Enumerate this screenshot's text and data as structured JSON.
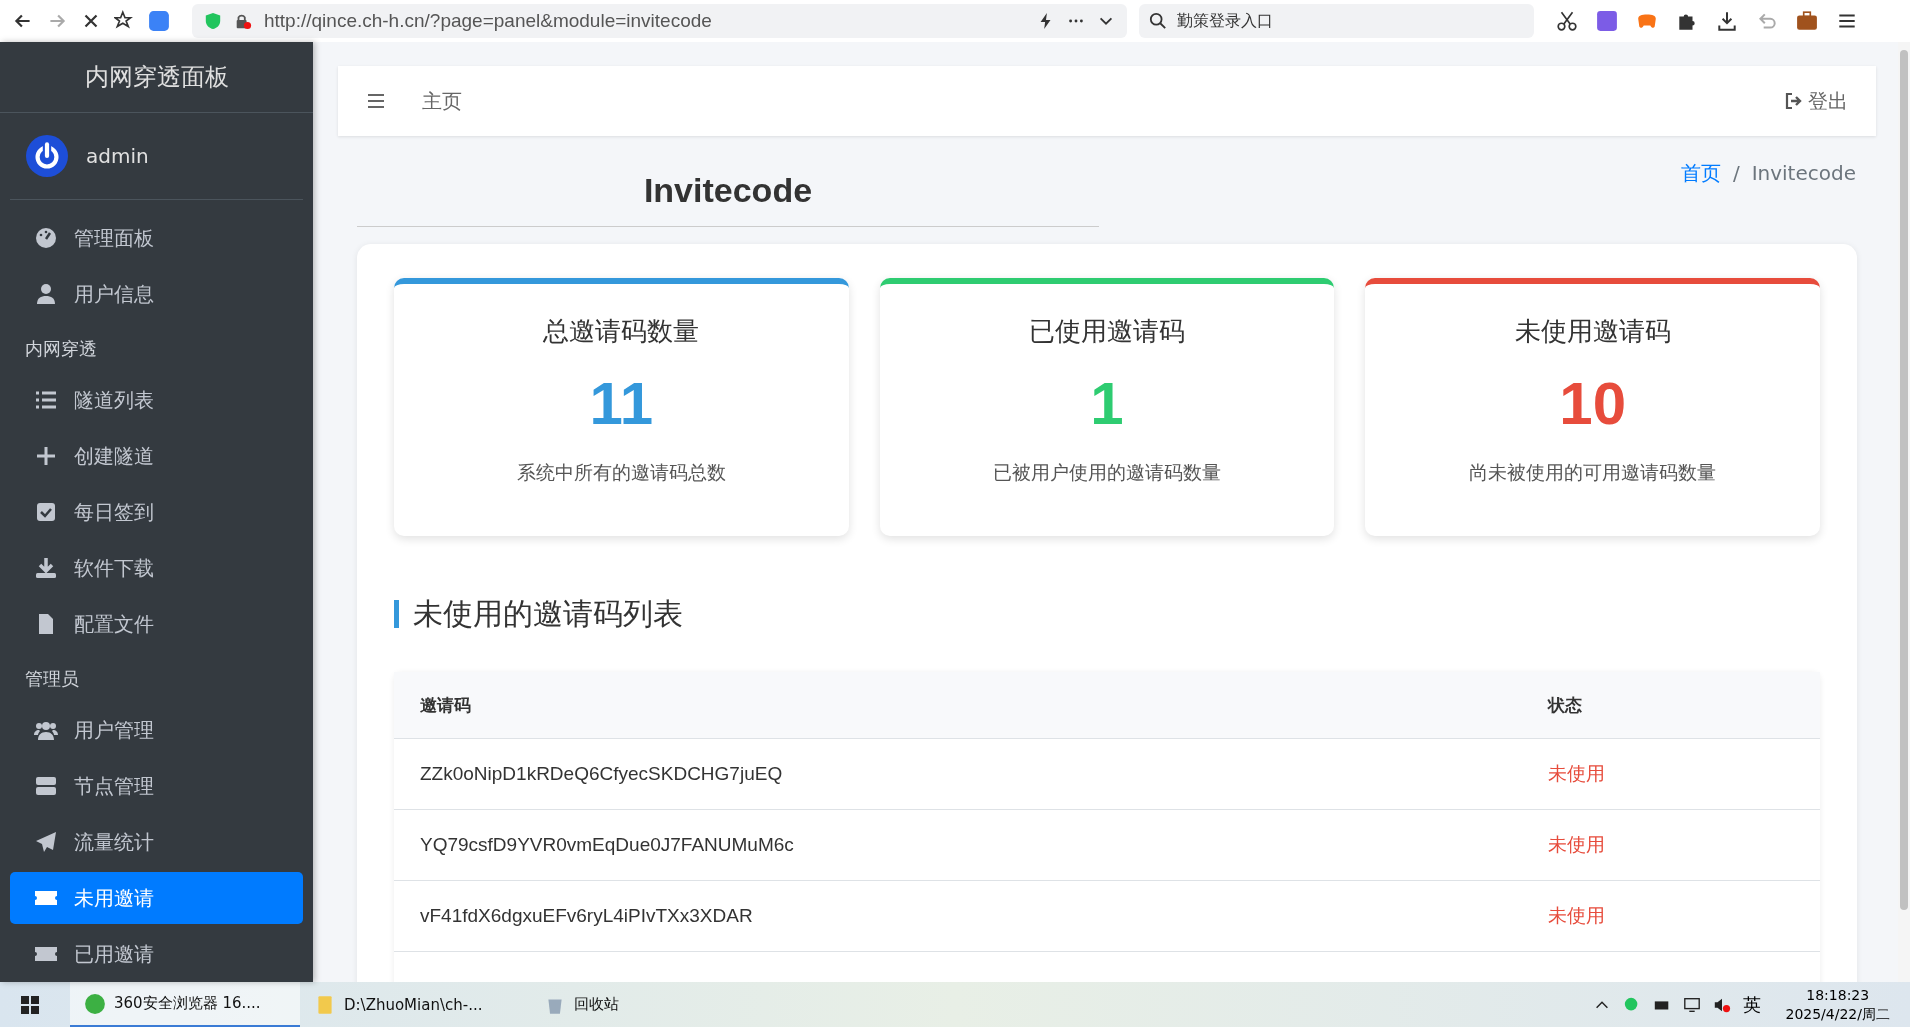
{
  "browser": {
    "url": "http://qince.ch-h.cn/?page=panel&module=invitecode",
    "search": {
      "placeholder": "勤策登录入口"
    }
  },
  "sidebar": {
    "title": "内网穿透面板",
    "user": {
      "name": "admin"
    },
    "items": [
      {
        "kind": "item",
        "label": "管理面板",
        "selected": false
      },
      {
        "kind": "item",
        "label": "用户信息",
        "selected": false
      },
      {
        "kind": "header",
        "label": "内网穿透"
      },
      {
        "kind": "item",
        "label": "隧道列表",
        "selected": false
      },
      {
        "kind": "item",
        "label": "创建隧道",
        "selected": false
      },
      {
        "kind": "item",
        "label": "每日签到",
        "selected": false
      },
      {
        "kind": "item",
        "label": "软件下载",
        "selected": false
      },
      {
        "kind": "item",
        "label": "配置文件",
        "selected": false
      },
      {
        "kind": "header",
        "label": "管理员"
      },
      {
        "kind": "item",
        "label": "用户管理",
        "selected": false
      },
      {
        "kind": "item",
        "label": "节点管理",
        "selected": false
      },
      {
        "kind": "item",
        "label": "流量统计",
        "selected": false
      },
      {
        "kind": "item",
        "label": "未用邀请",
        "selected": true
      },
      {
        "kind": "item",
        "label": "已用邀请",
        "selected": false
      }
    ]
  },
  "topbar": {
    "home": "主页",
    "logout": "登出"
  },
  "page": {
    "title": "Invitecode",
    "breadcrumb": [
      "首页",
      "Invitecode"
    ],
    "breadcrumb_separator": "/"
  },
  "stats": [
    {
      "title": "总邀请码数量",
      "value": "11",
      "description": "系统中所有的邀请码总数",
      "color": "#3498db"
    },
    {
      "title": "已使用邀请码",
      "value": "1",
      "description": "已被用户使用的邀请码数量",
      "color": "#2ecc71"
    },
    {
      "title": "未使用邀请码",
      "value": "10",
      "description": "尚未被使用的可用邀请码数量",
      "color": "#e74c3c"
    }
  ],
  "section_title": "未使用的邀请码列表",
  "table": {
    "columns": [
      "邀请码",
      "状态"
    ],
    "rows": [
      {
        "code": "ZZk0oNipD1kRDeQ6CfyecSKDCHG7juEQ",
        "status": "未使用"
      },
      {
        "code": "YQ79csfD9YVR0vmEqDue0J7FANUMuM6c",
        "status": "未使用"
      },
      {
        "code": "vF41fdX6dgxuEFv6ryL4iPIvTXx3XDAR",
        "status": "未使用"
      }
    ]
  },
  "taskbar": {
    "apps": [
      {
        "label": "360安全浏览器 16....",
        "selected": true
      },
      {
        "label": "D:\\ZhuoMian\\ch-...",
        "selected": false
      },
      {
        "label": "回收站",
        "selected": false
      }
    ],
    "ime": "英",
    "time": "18:18:23",
    "date": "2025/4/22/周二"
  }
}
